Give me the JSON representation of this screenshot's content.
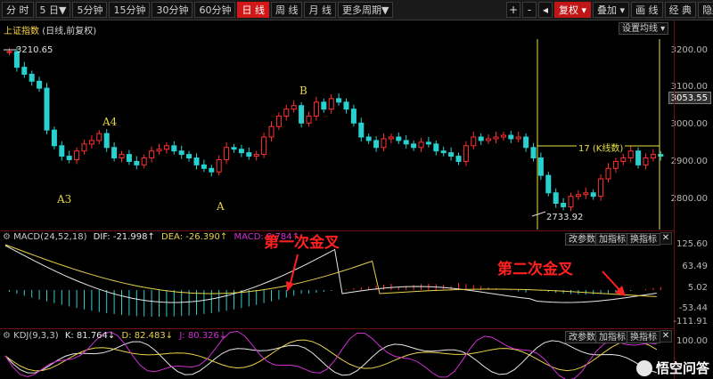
{
  "toolbar": {
    "periods": [
      "分 时",
      "5 日▼",
      "5分钟",
      "15分钟",
      "30分钟",
      "60分钟",
      "日 线",
      "周 线",
      "月 线",
      "更多周期▼"
    ],
    "active_index": 6,
    "right_buttons": {
      "plus": "+",
      "minus": "-",
      "left": "◂",
      "fuquan": "复权 ▾",
      "add": "叠加 ▾",
      "draw": "画 线",
      "classic": "经 典",
      "hide": "隐藏▲"
    }
  },
  "main_panel": {
    "title": "上证指数",
    "subtitle": "(日线,前复权)",
    "settings_button": "设置均线 ▾",
    "y_labels": [
      "3200.00",
      "3100.00",
      "3000.00",
      "2900.00",
      "2800.00"
    ],
    "current_price": "3053.55",
    "high_label": "3210.65",
    "low_label": "2733.92",
    "range_label": "17 (K线数)",
    "marks": [
      "A3",
      "A4",
      "A",
      "B"
    ]
  },
  "macd_panel": {
    "title": "MACD(24,52,18)",
    "dif_label": "DIF: -21.998",
    "dea_label": "DEA: -26.390",
    "macd_label": "MACD: 8.784",
    "buttons": [
      "改参数",
      "加指标",
      "换指标"
    ],
    "y_labels": [
      "125.60",
      "63.49",
      "5.02",
      "-53.44",
      "-111.91"
    ],
    "annotation_1": "第一次金叉",
    "annotation_2": "第二次金叉"
  },
  "kdj_panel": {
    "title": "KDJ(9,3,3)",
    "k_label": "K: 81.764",
    "d_label": "D: 82.483",
    "j_label": "J: 80.326",
    "buttons": [
      "改参数",
      "加指标",
      "换指标"
    ],
    "y_labels": [
      "100.00"
    ]
  },
  "watermark": "悟空问答",
  "colors": {
    "up": "#ff3030",
    "down": "#28d0d0",
    "accent": "#d01818",
    "dif": "#e8e8e8",
    "dea": "#e8d24a"
  }
}
